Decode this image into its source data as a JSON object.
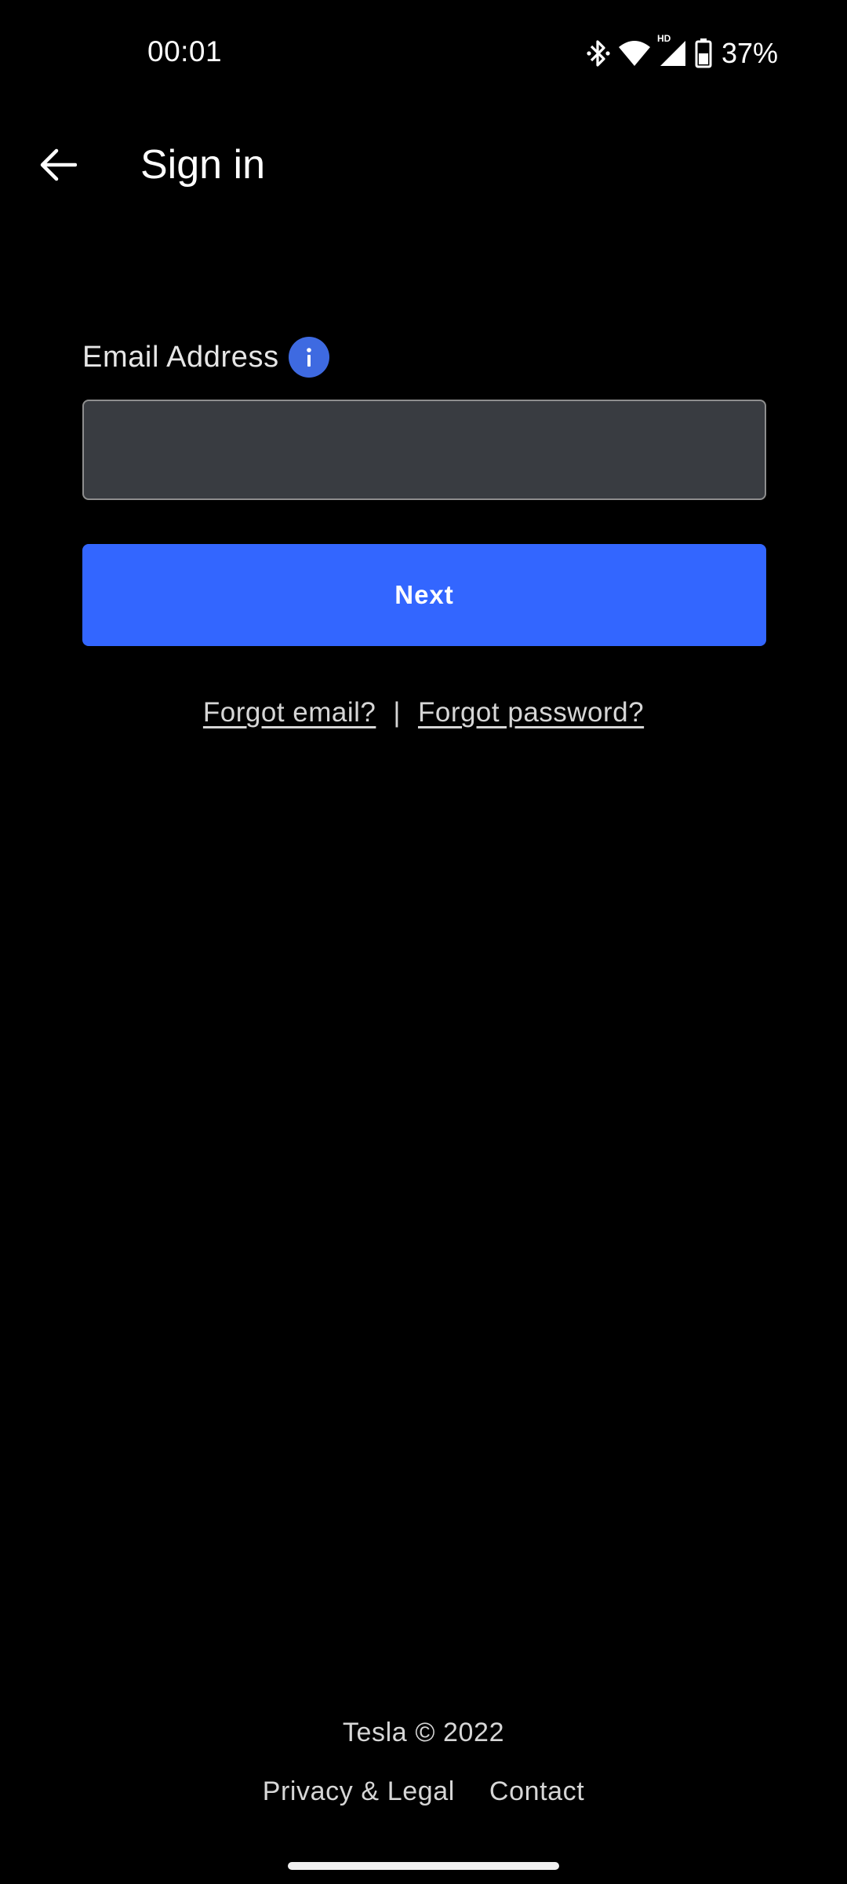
{
  "status_bar": {
    "time": "00:01",
    "battery_percent": "37%",
    "icons": [
      "bluetooth-icon",
      "wifi-icon",
      "hd-icon",
      "cell-signal-icon",
      "battery-icon"
    ],
    "hd_label": "HD"
  },
  "app_bar": {
    "back_icon": "arrow-left-icon",
    "title": "Sign in"
  },
  "form": {
    "email_label": "Email Address",
    "info_icon_glyph": "i",
    "email_value": "",
    "email_placeholder": "",
    "next_label": "Next",
    "forgot_email": "Forgot email?",
    "separator": "|",
    "forgot_password": "Forgot password?"
  },
  "footer": {
    "copyright": "Tesla © 2022",
    "privacy_legal": "Privacy & Legal",
    "contact": "Contact"
  },
  "colors": {
    "background": "#000000",
    "accent": "#3366ff",
    "info_badge": "#3e6ae1",
    "input_bg": "#393c41"
  }
}
